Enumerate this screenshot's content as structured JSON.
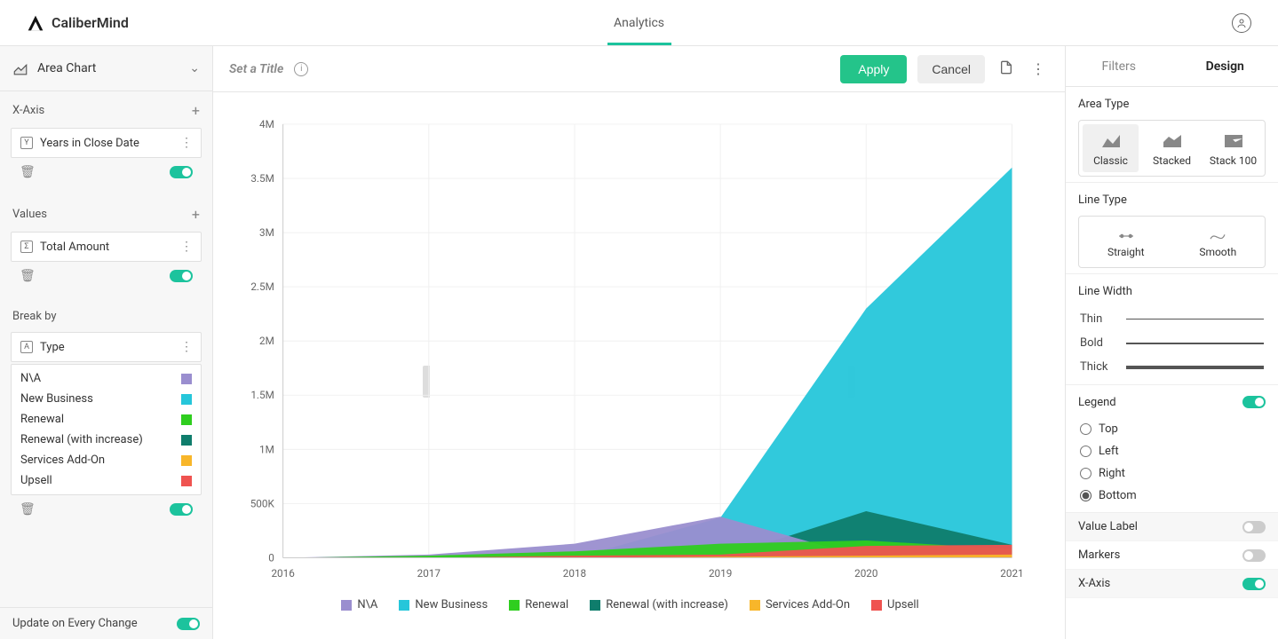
{
  "header": {
    "brand": "CaliberMind",
    "active_tab": "Analytics"
  },
  "left": {
    "chart_type": "Area Chart",
    "xaxis_label": "X-Axis",
    "values_label": "Values",
    "breakby_label": "Break by",
    "xaxis_field": "Years in Close Date",
    "values_field": "Total Amount",
    "breakby_field": "Type",
    "break_items": [
      {
        "name": "N\\A",
        "color": "#9a8ecf"
      },
      {
        "name": "New Business",
        "color": "#26c6da"
      },
      {
        "name": "Renewal",
        "color": "#2fce1f"
      },
      {
        "name": "Renewal (with increase)",
        "color": "#0f7d6c"
      },
      {
        "name": "Services Add-On",
        "color": "#f8b62a"
      },
      {
        "name": "Upsell",
        "color": "#ef5350"
      }
    ],
    "update_label": "Update on Every Change"
  },
  "toolbar": {
    "title_placeholder": "Set a Title",
    "apply": "Apply",
    "cancel": "Cancel"
  },
  "right": {
    "tab_filters": "Filters",
    "tab_design": "Design",
    "area_type_label": "Area Type",
    "area_types": [
      "Classic",
      "Stacked",
      "Stack 100"
    ],
    "line_type_label": "Line Type",
    "line_types": [
      "Straight",
      "Smooth"
    ],
    "line_width_label": "Line Width",
    "line_widths": [
      "Thin",
      "Bold",
      "Thick"
    ],
    "legend_label": "Legend",
    "legend_positions": [
      "Top",
      "Left",
      "Right",
      "Bottom"
    ],
    "legend_selected": "Bottom",
    "value_label": "Value Label",
    "markers": "Markers",
    "xaxis": "X-Axis"
  },
  "chart_data": {
    "type": "area",
    "xlabel": "",
    "ylabel": "",
    "ylim": [
      0,
      4000000
    ],
    "yticks": [
      "0",
      "500K",
      "1M",
      "1.5M",
      "2M",
      "2.5M",
      "3M",
      "3.5M",
      "4M"
    ],
    "categories": [
      "2016",
      "2017",
      "2018",
      "2019",
      "2020",
      "2021"
    ],
    "series": [
      {
        "name": "N\\A",
        "color": "#9a8ecf",
        "values": [
          0,
          30000,
          130000,
          380000,
          0,
          0
        ]
      },
      {
        "name": "New Business",
        "color": "#26c6da",
        "values": [
          0,
          0,
          0,
          370000,
          2300000,
          3600000
        ]
      },
      {
        "name": "Renewal",
        "color": "#2fce1f",
        "values": [
          0,
          20000,
          60000,
          130000,
          160000,
          80000
        ]
      },
      {
        "name": "Renewal (with increase)",
        "color": "#0f7d6c",
        "values": [
          0,
          0,
          0,
          0,
          430000,
          120000
        ]
      },
      {
        "name": "Services Add-On",
        "color": "#f8b62a",
        "values": [
          0,
          0,
          0,
          10000,
          20000,
          30000
        ]
      },
      {
        "name": "Upsell",
        "color": "#ef5350",
        "values": [
          0,
          0,
          20000,
          30000,
          110000,
          120000
        ]
      }
    ]
  }
}
